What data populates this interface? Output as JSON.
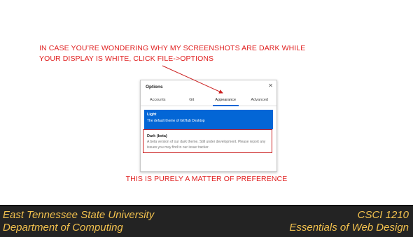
{
  "slide": {
    "top_text_line1": "IN CASE YOU’RE WONDERING WHY MY SCREENSHOTS ARE DARK WHILE",
    "top_text_line2": "YOUR DISPLAY IS WHITE, CLICK FILE->OPTIONS",
    "bottom_text": "THIS IS PURELY A MATTER OF PREFERENCE",
    "accent_color": "#e02020"
  },
  "dialog": {
    "title": "Options",
    "close_icon": "close-icon",
    "tabs": [
      {
        "label": "Accounts"
      },
      {
        "label": "Git"
      },
      {
        "label": "Appearance"
      },
      {
        "label": "Advanced"
      }
    ],
    "active_tab": "Appearance",
    "themes": {
      "light": {
        "title": "Light",
        "description": "The default theme of GitHub Desktop"
      },
      "dark": {
        "title": "Dark (beta)",
        "description": "A beta version of our dark theme. Still under development. Please report any issues you may find to our issue tracker."
      }
    },
    "selected_color": "#0366d6"
  },
  "footer": {
    "left_line1": "East Tennessee State University",
    "left_line2": "Department of Computing",
    "right_line1": "CSCI 1210",
    "right_line2": "Essentials of Web Design",
    "text_color": "#f2c14e",
    "bg_color": "#232323"
  }
}
